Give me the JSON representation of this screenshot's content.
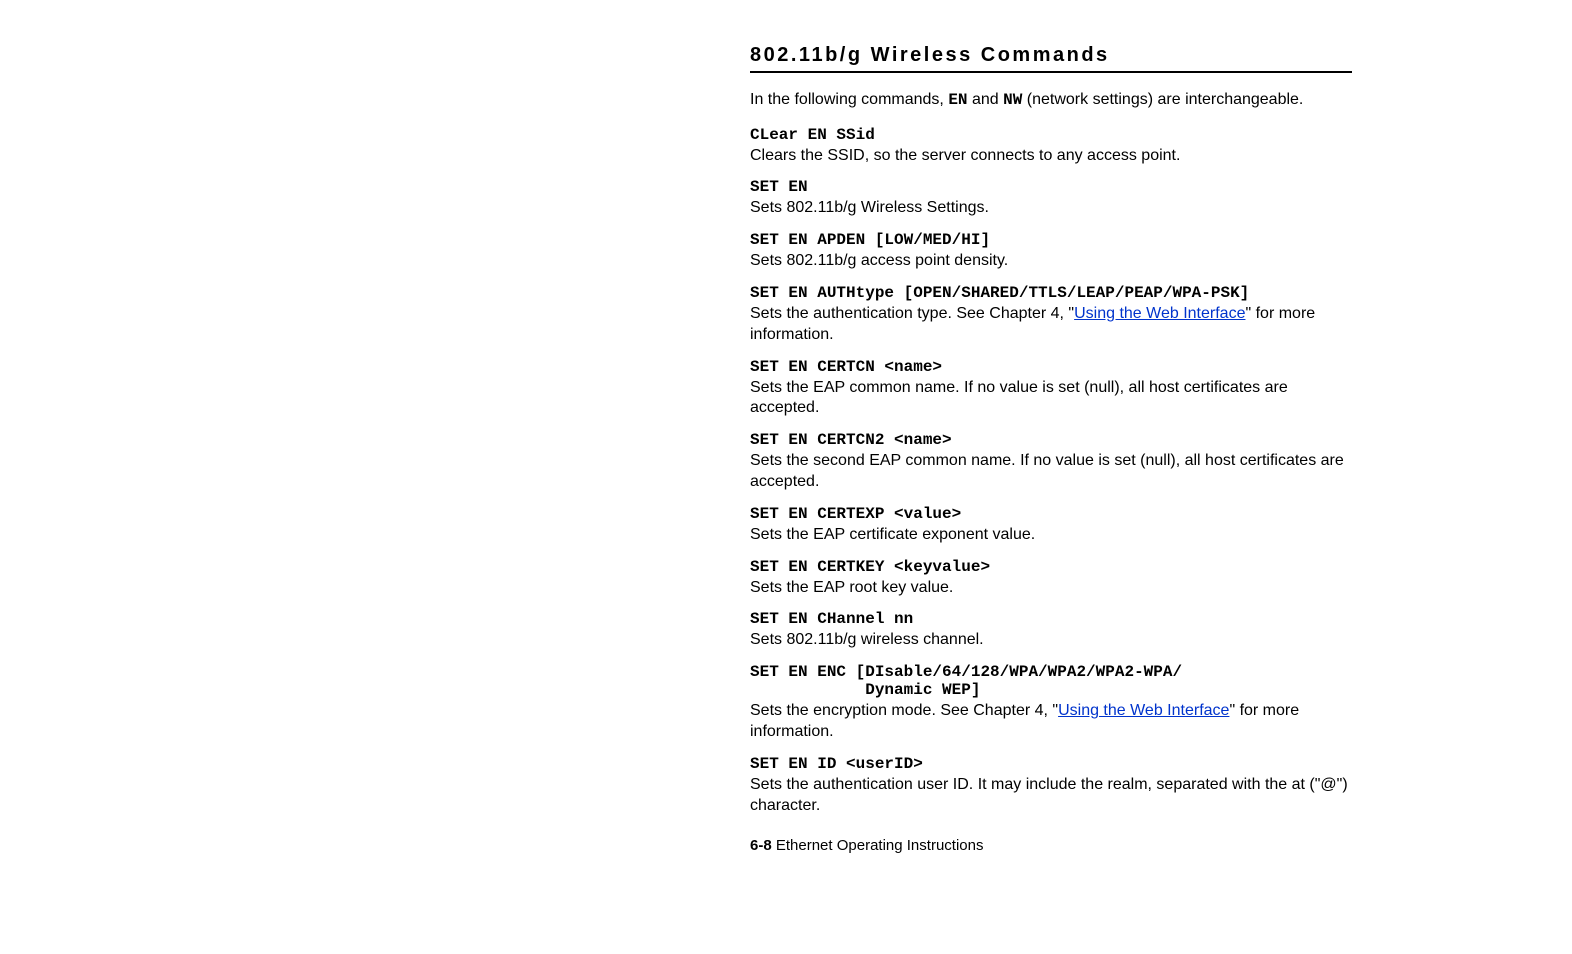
{
  "section_title": "802.11b/g Wireless Commands",
  "intro": {
    "pre": "In the following commands, ",
    "code1": "EN",
    "mid1": " and ",
    "code2": "NW",
    "post": " (network settings) are interchangeable."
  },
  "entries": [
    {
      "cmd": "CLear EN SSid",
      "desc_parts": [
        {
          "t": "text",
          "v": "Clears the SSID, so the server connects to any access point."
        }
      ]
    },
    {
      "cmd": "SET EN",
      "desc_parts": [
        {
          "t": "text",
          "v": "Sets 802.11b/g Wireless Settings."
        }
      ]
    },
    {
      "cmd": "SET EN APDEN [LOW/MED/HI]",
      "desc_parts": [
        {
          "t": "text",
          "v": "Sets 802.11b/g access point density."
        }
      ]
    },
    {
      "cmd": "SET EN AUTHtype [OPEN/SHARED/TTLS/LEAP/PEAP/WPA-PSK]",
      "desc_parts": [
        {
          "t": "text",
          "v": "Sets the authentication type.  See Chapter 4, \""
        },
        {
          "t": "link",
          "v": "Using the Web Interface"
        },
        {
          "t": "text",
          "v": "\" for more information."
        }
      ]
    },
    {
      "cmd": "SET EN CERTCN <name>",
      "desc_parts": [
        {
          "t": "text",
          "v": "Sets the EAP common name.  If no value is set (null), all host certificates are accepted."
        }
      ]
    },
    {
      "cmd": "SET EN CERTCN2 <name>",
      "desc_parts": [
        {
          "t": "text",
          "v": "Sets the second EAP common name.  If no value is set (null), all host certificates are accepted."
        }
      ]
    },
    {
      "cmd": "SET EN CERTEXP <value>",
      "desc_parts": [
        {
          "t": "text",
          "v": "Sets the EAP certificate exponent value."
        }
      ]
    },
    {
      "cmd": "SET EN CERTKEY <keyvalue>",
      "desc_parts": [
        {
          "t": "text",
          "v": "Sets the EAP root key value."
        }
      ]
    },
    {
      "cmd": "SET EN CHannel nn",
      "desc_parts": [
        {
          "t": "text",
          "v": "Sets 802.11b/g wireless channel."
        }
      ]
    },
    {
      "cmd": "SET EN ENC [DIsable/64/128/WPA/WPA2/WPA2-WPA/\n            Dynamic WEP]",
      "desc_parts": [
        {
          "t": "text",
          "v": "Sets the encryption mode.  See Chapter 4, \""
        },
        {
          "t": "link",
          "v": "Using the Web Interface"
        },
        {
          "t": "text",
          "v": "\" for more information."
        }
      ]
    },
    {
      "cmd": "SET EN ID <userID>",
      "desc_parts": [
        {
          "t": "text",
          "v": "Sets the authentication user ID.  It may include the realm, separated with the at (\"@\") character."
        }
      ]
    }
  ],
  "footer": {
    "page_num": "6-8",
    "suffix": " Ethernet Operating Instructions"
  }
}
